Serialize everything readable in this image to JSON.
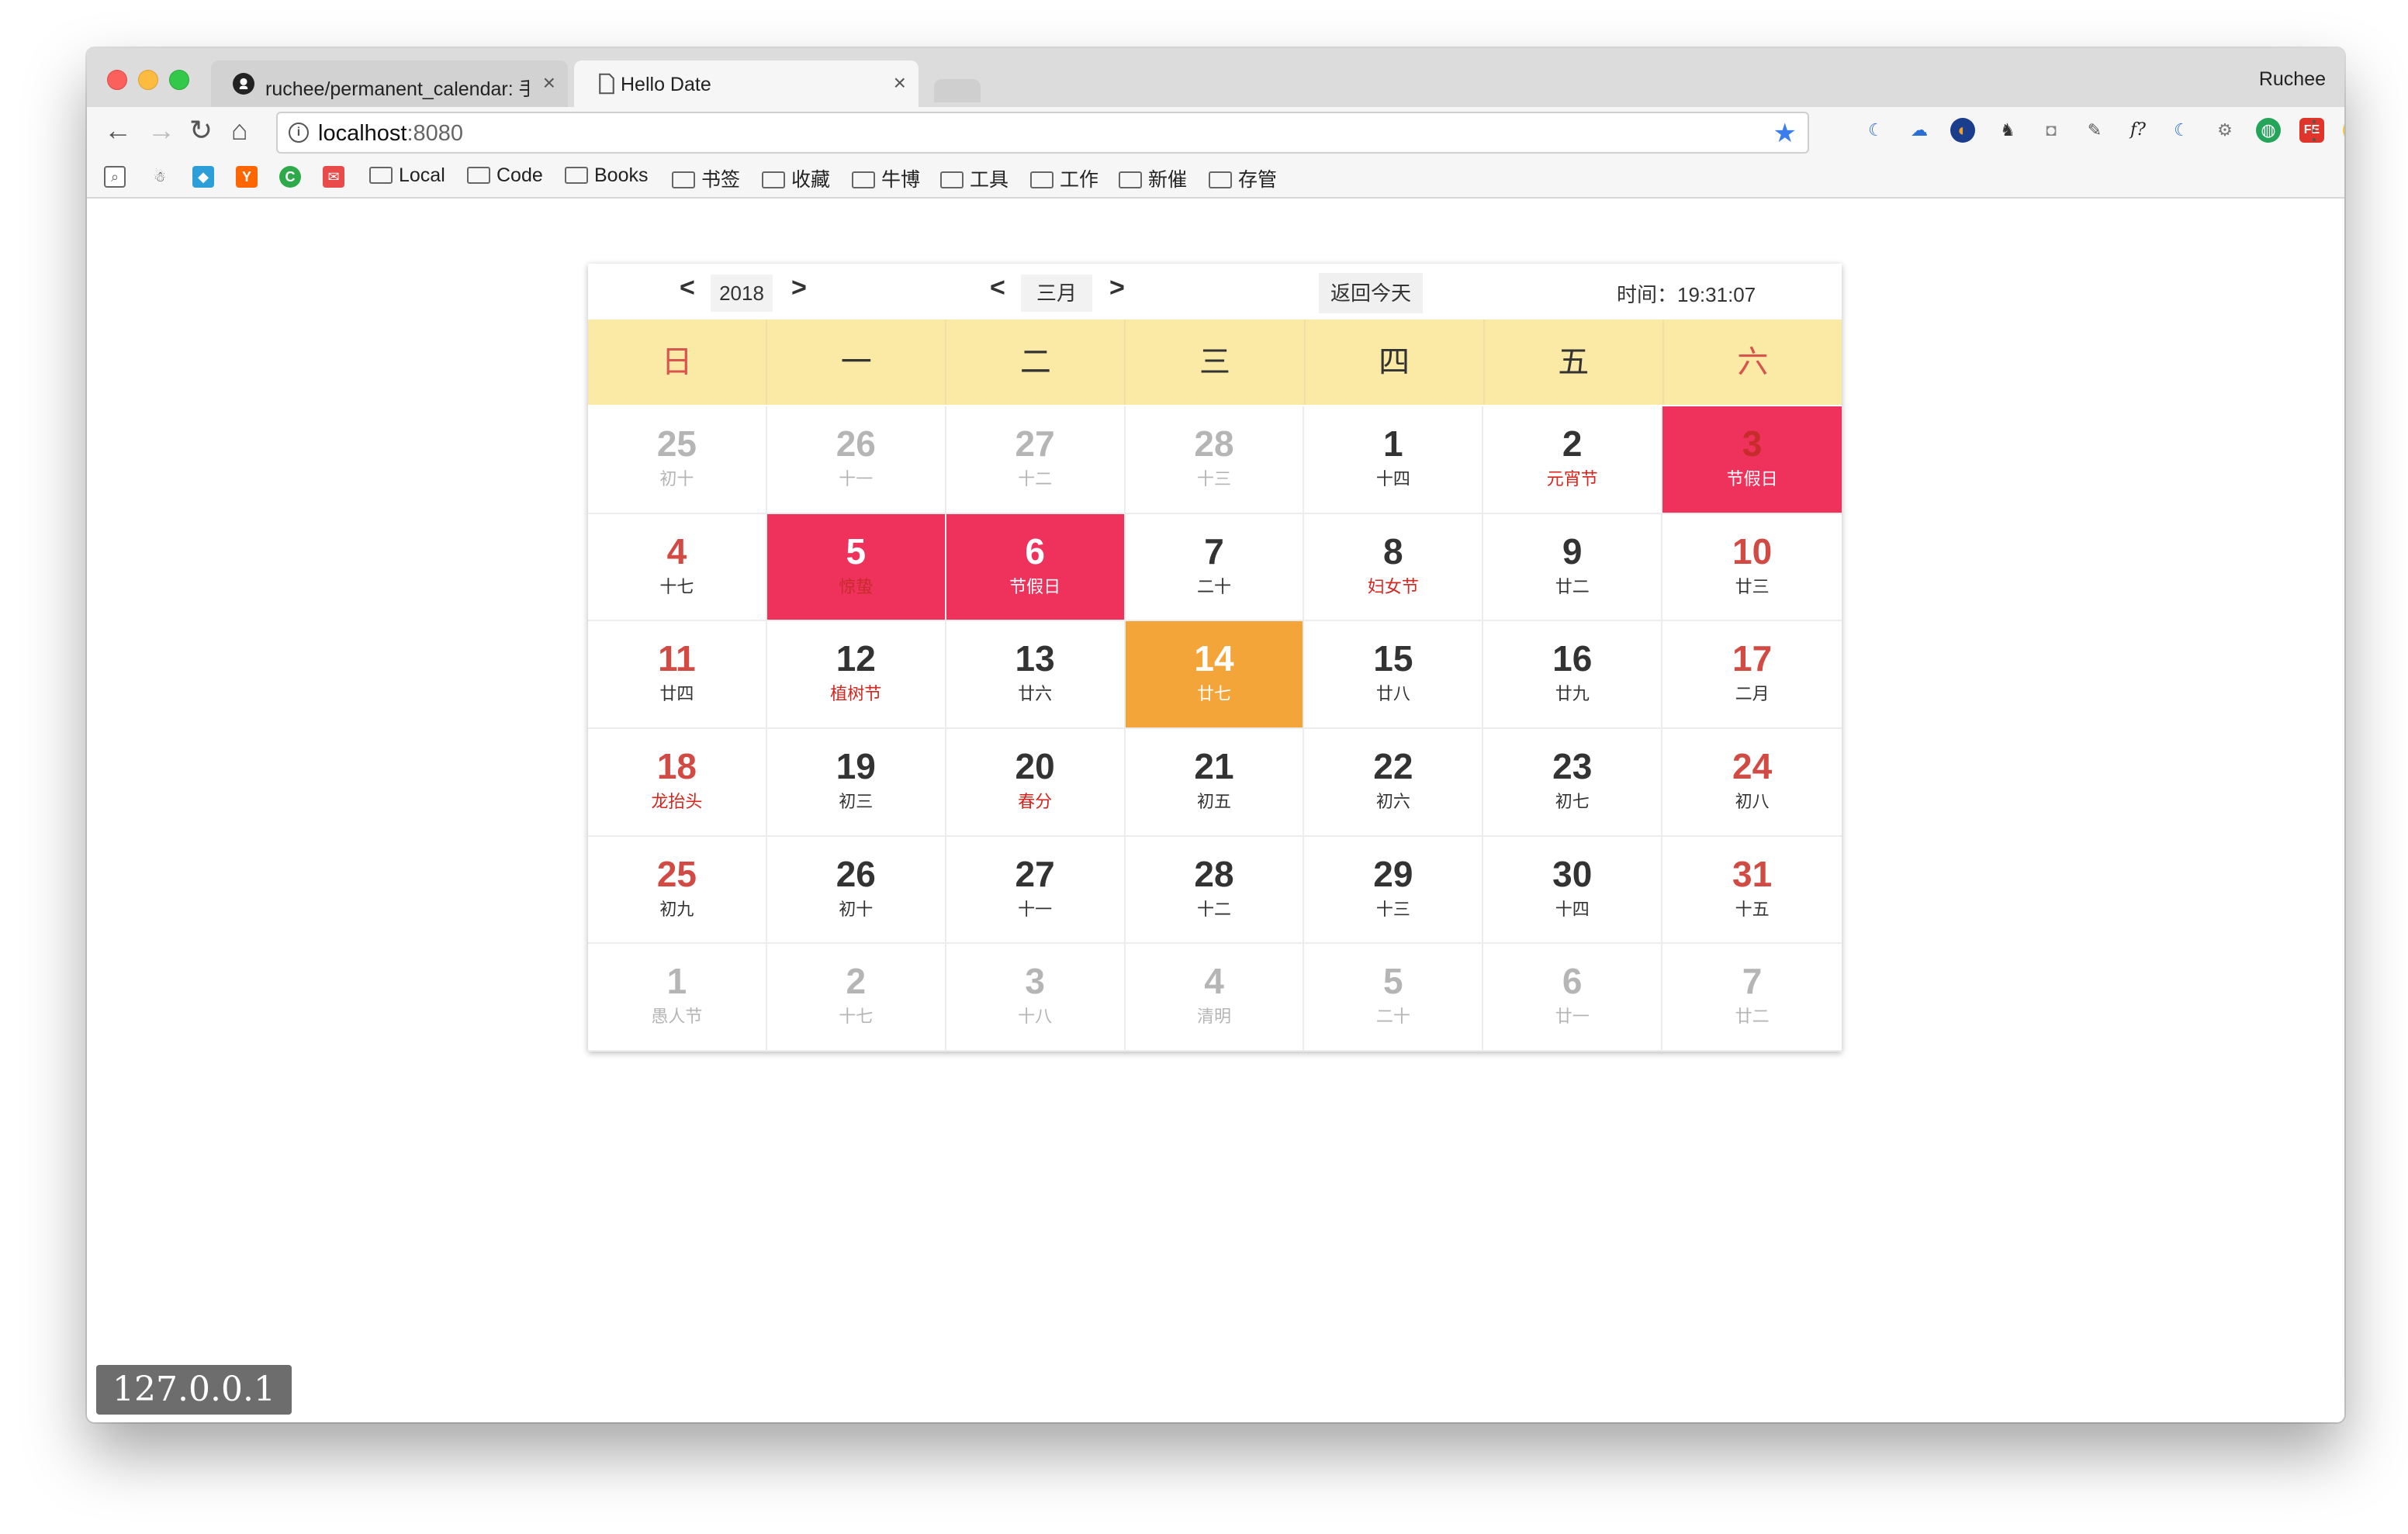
{
  "browser": {
    "tabs": [
      {
        "title": "ruchee/permanent_calendar: 手",
        "icon": "github-icon"
      },
      {
        "title": "Hello Date",
        "icon": "document-icon"
      }
    ],
    "profile_name": "Ruchee",
    "url_host": "localhost",
    "url_port": ":8080",
    "bookmarks": [
      "Local",
      "Code",
      "Books",
      "书签",
      "收藏",
      "牛博",
      "工具",
      "工作",
      "新催",
      "存管"
    ],
    "ip_badge": "127.0.0.1"
  },
  "calendar": {
    "year": "2018",
    "month": "三月",
    "today_button": "返回今天",
    "time_label": "时间：",
    "time_value": "19:31:07",
    "weekdays": [
      "日",
      "一",
      "二",
      "三",
      "四",
      "五",
      "六"
    ],
    "rows": [
      [
        [
          "25",
          "初十"
        ],
        [
          "26",
          "十一"
        ],
        [
          "27",
          "十二"
        ],
        [
          "28",
          "十三"
        ],
        [
          "1",
          "十四"
        ],
        [
          "2",
          "元宵节"
        ],
        [
          "3",
          "节假日"
        ]
      ],
      [
        [
          "4",
          "十七"
        ],
        [
          "5",
          "惊蛰"
        ],
        [
          "6",
          "节假日"
        ],
        [
          "7",
          "二十"
        ],
        [
          "8",
          "妇女节"
        ],
        [
          "9",
          "廿二"
        ],
        [
          "10",
          "廿三"
        ]
      ],
      [
        [
          "11",
          "廿四"
        ],
        [
          "12",
          "植树节"
        ],
        [
          "13",
          "廿六"
        ],
        [
          "14",
          "廿七"
        ],
        [
          "15",
          "廿八"
        ],
        [
          "16",
          "廿九"
        ],
        [
          "17",
          "二月"
        ]
      ],
      [
        [
          "18",
          "龙抬头"
        ],
        [
          "19",
          "初三"
        ],
        [
          "20",
          "春分"
        ],
        [
          "21",
          "初五"
        ],
        [
          "22",
          "初六"
        ],
        [
          "23",
          "初七"
        ],
        [
          "24",
          "初八"
        ]
      ],
      [
        [
          "25",
          "初九"
        ],
        [
          "26",
          "初十"
        ],
        [
          "27",
          "十一"
        ],
        [
          "28",
          "十二"
        ],
        [
          "29",
          "十三"
        ],
        [
          "30",
          "十四"
        ],
        [
          "31",
          "十五"
        ]
      ],
      [
        [
          "1",
          "愚人节"
        ],
        [
          "2",
          "十七"
        ],
        [
          "3",
          "十八"
        ],
        [
          "4",
          "清明"
        ],
        [
          "5",
          "二十"
        ],
        [
          "6",
          "廿一"
        ],
        [
          "7",
          "廿二"
        ]
      ]
    ]
  }
}
